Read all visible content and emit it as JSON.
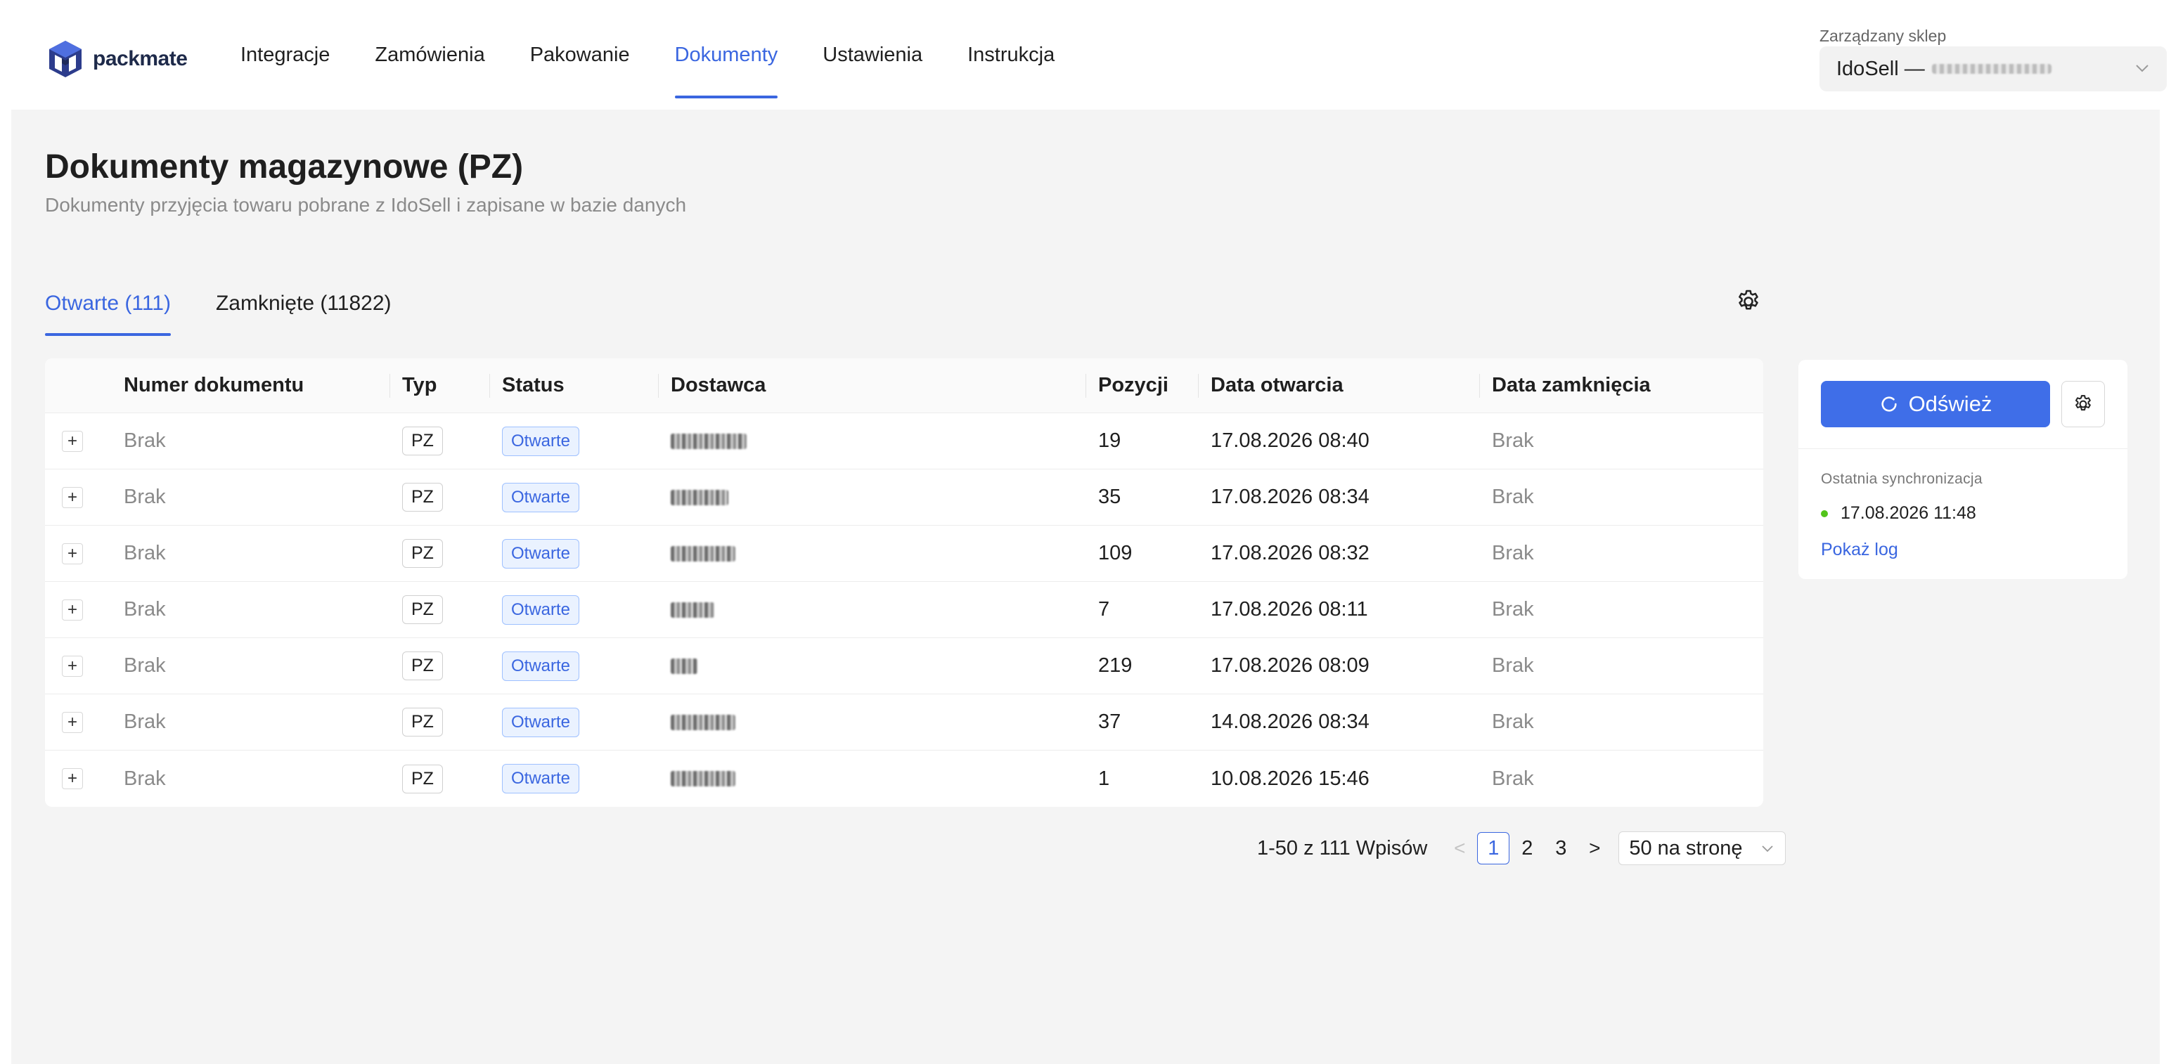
{
  "app": {
    "logo_text": "packmate"
  },
  "nav": {
    "items": [
      {
        "label": "Integracje",
        "active": false
      },
      {
        "label": "Zamówienia",
        "active": false
      },
      {
        "label": "Pakowanie",
        "active": false
      },
      {
        "label": "Dokumenty",
        "active": true
      },
      {
        "label": "Ustawienia",
        "active": false
      },
      {
        "label": "Instrukcja",
        "active": false
      }
    ]
  },
  "shop": {
    "label": "Zarządzany sklep",
    "value": "IdoSell —"
  },
  "page": {
    "title": "Dokumenty magazynowe (PZ)",
    "subtitle": "Dokumenty przyjęcia towaru pobrane z IdoSell i zapisane w bazie danych"
  },
  "tabs": [
    {
      "label": "Otwarte (111)",
      "active": true
    },
    {
      "label": "Zamknięte (11822)",
      "active": false
    }
  ],
  "table": {
    "headers": {
      "number": "Numer dokumentu",
      "type": "Typ",
      "status": "Status",
      "supplier": "Dostawca",
      "positions": "Pozycji",
      "opened": "Data otwarcia",
      "closed": "Data zamknięcia"
    },
    "expand_symbol": "+",
    "rows": [
      {
        "number": "Brak",
        "type": "PZ",
        "status": "Otwarte",
        "positions": "19",
        "opened": "17.08.2026 08:40",
        "closed": "Brak"
      },
      {
        "number": "Brak",
        "type": "PZ",
        "status": "Otwarte",
        "positions": "35",
        "opened": "17.08.2026 08:34",
        "closed": "Brak"
      },
      {
        "number": "Brak",
        "type": "PZ",
        "status": "Otwarte",
        "positions": "109",
        "opened": "17.08.2026 08:32",
        "closed": "Brak"
      },
      {
        "number": "Brak",
        "type": "PZ",
        "status": "Otwarte",
        "positions": "7",
        "opened": "17.08.2026 08:11",
        "closed": "Brak"
      },
      {
        "number": "Brak",
        "type": "PZ",
        "status": "Otwarte",
        "positions": "219",
        "opened": "17.08.2026 08:09",
        "closed": "Brak"
      },
      {
        "number": "Brak",
        "type": "PZ",
        "status": "Otwarte",
        "positions": "37",
        "opened": "14.08.2026 08:34",
        "closed": "Brak"
      },
      {
        "number": "Brak",
        "type": "PZ",
        "status": "Otwarte",
        "positions": "1",
        "opened": "10.08.2026 15:46",
        "closed": "Brak"
      }
    ]
  },
  "pagination": {
    "total_text": "1-50 z 111 Wpisów",
    "prev": "<",
    "next": ">",
    "pages": [
      "1",
      "2",
      "3"
    ],
    "current_page": "1",
    "page_size": "50 na stronę"
  },
  "sync": {
    "refresh_label": "Odśwież",
    "last_sync_label": "Ostatnia synchronizacja",
    "last_sync_time": "17.08.2026 11:48",
    "status_color": "#52c41a",
    "show_log": "Pokaż log"
  },
  "colors": {
    "accent": "#3a66e0",
    "primary_button": "#3f6ee8",
    "background": "#f4f4f4"
  }
}
